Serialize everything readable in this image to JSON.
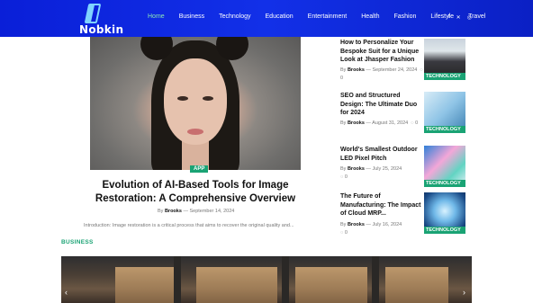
{
  "header": {
    "logo_text": "Nobkin",
    "nav": [
      "Home",
      "Business",
      "Technology",
      "Education",
      "Entertainment",
      "Health",
      "Fashion",
      "Lifestyle",
      "Travel"
    ],
    "active_nav": "Home",
    "social": [
      "f",
      "✕",
      "◎"
    ],
    "social_icons": [
      "facebook-icon",
      "x-icon",
      "instagram-icon"
    ]
  },
  "hero": {
    "tag": "APP",
    "title": "Evolution of AI-Based Tools for Image Restoration: A Comprehensive Overview",
    "by": "By",
    "author": "Brooks",
    "date": "September 14, 2024",
    "excerpt": "Introduction: Image restoration is a critical process that aims to recover the original quality and...",
    "image_alt": "portrait of a woman with dark hair buns"
  },
  "section": {
    "label": "BUSINESS"
  },
  "sidebar": [
    {
      "title": "How to Personalize Your Bespoke Suit for a Unique Look at Jhasper Fashion",
      "by": "By",
      "author": "Brooks",
      "date": "September 24, 2024",
      "comments": "0",
      "category": "TECHNOLOGY"
    },
    {
      "title": "SEO and Structured Design: The Ultimate Duo for 2024",
      "by": "By",
      "author": "Brooks",
      "date": "August 31, 2024",
      "comments": "0",
      "category": "TECHNOLOGY"
    },
    {
      "title": "World's Smallest Outdoor LED Pixel Pitch",
      "by": "By",
      "author": "Brooks",
      "date": "July 25, 2024",
      "comments": "0",
      "category": "TECHNOLOGY"
    },
    {
      "title": "The Future of Manufacturing: The Impact of Cloud MRP...",
      "by": "By",
      "author": "Brooks",
      "date": "July 16, 2024",
      "comments": "0",
      "category": "TECHNOLOGY"
    }
  ],
  "colors": {
    "header": "#1230e8",
    "accent": "#1aa374",
    "active_nav": "#8ae6b6"
  }
}
